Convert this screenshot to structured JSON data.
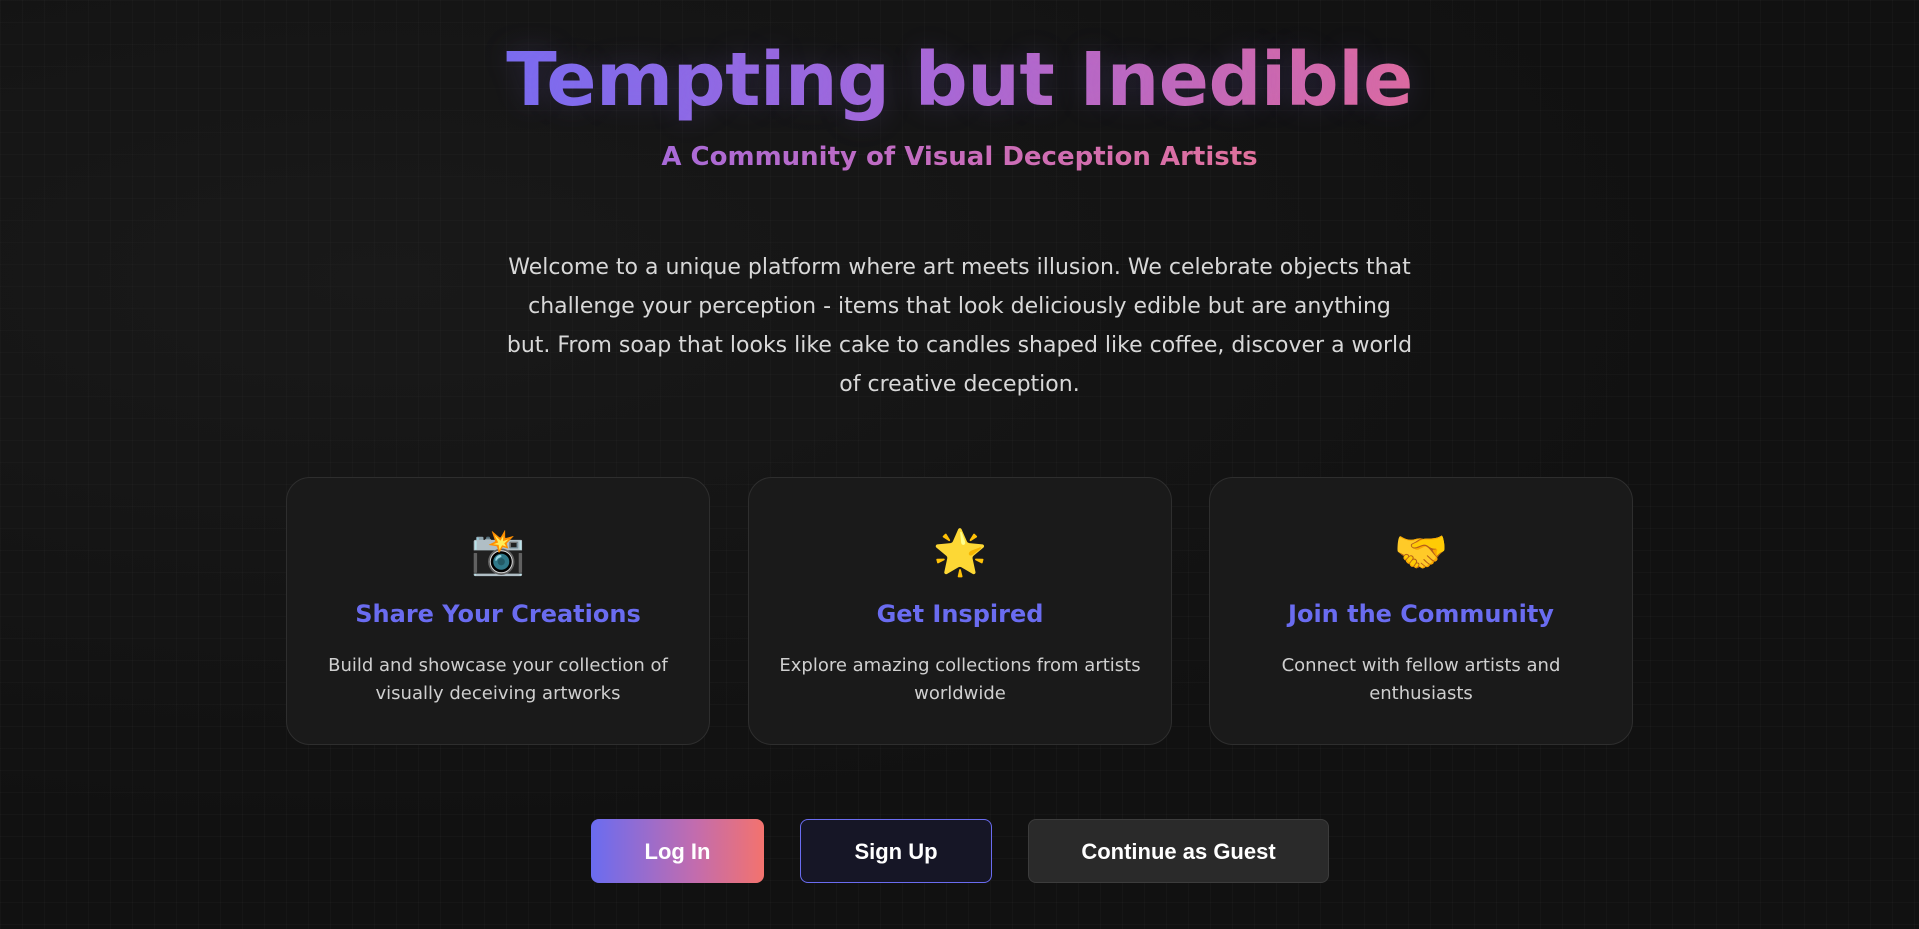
{
  "hero": {
    "title": "Tempting but Inedible",
    "subtitle": "A Community of Visual Deception Artists",
    "intro": "Welcome to a unique platform where art meets illusion. We celebrate objects that challenge your perception - items that look deliciously edible but are anything but. From soap that looks like cake to candles shaped like coffee, discover a world of creative deception."
  },
  "features": [
    {
      "icon": "camera-flash-icon",
      "glyph": "📸",
      "title": "Share Your Creations",
      "description": "Build and showcase your collection of visually deceiving artworks"
    },
    {
      "icon": "glowing-star-icon",
      "glyph": "🌟",
      "title": "Get Inspired",
      "description": "Explore amazing collections from artists worldwide"
    },
    {
      "icon": "handshake-icon",
      "glyph": "🤝",
      "title": "Join the Community",
      "description": "Connect with fellow artists and enthusiasts"
    }
  ],
  "actions": {
    "login_label": "Log In",
    "signup_label": "Sign Up",
    "guest_label": "Continue as Guest"
  },
  "colors": {
    "background": "#111111",
    "accent": "#6a6cf0",
    "gradient_start": "#6a6cf0",
    "gradient_end": "#f3736e"
  }
}
